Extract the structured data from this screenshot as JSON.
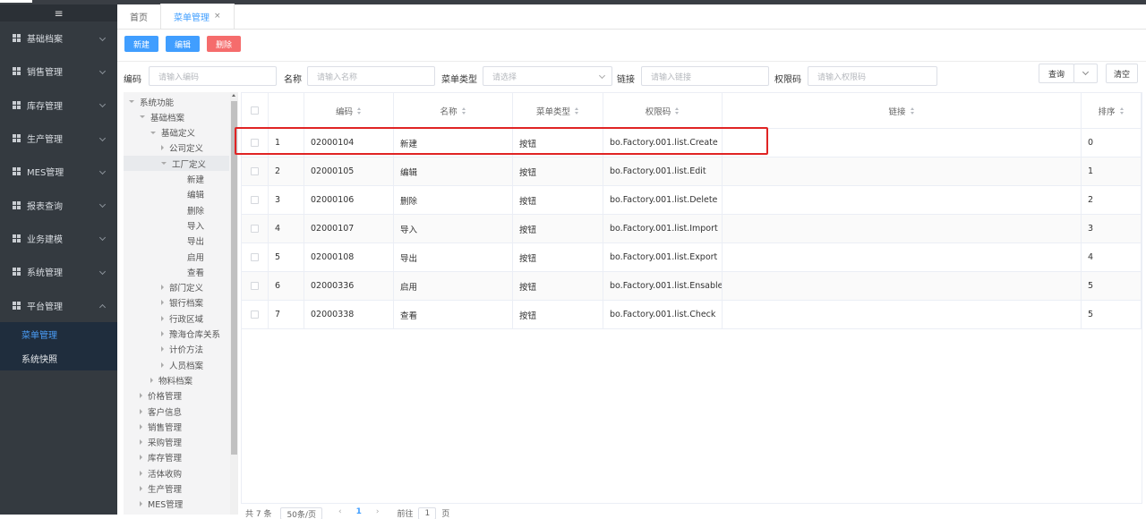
{
  "sidebar": {
    "toggle_icon": "≡",
    "items": [
      {
        "label": "基础档案"
      },
      {
        "label": "销售管理"
      },
      {
        "label": "库存管理"
      },
      {
        "label": "生产管理"
      },
      {
        "label": "MES管理"
      },
      {
        "label": "报表查询"
      },
      {
        "label": "业务建模"
      },
      {
        "label": "系统管理"
      },
      {
        "label": "平台管理"
      }
    ],
    "sub_items": [
      {
        "label": "菜单管理",
        "active": true
      },
      {
        "label": "系统快照",
        "active": false
      }
    ]
  },
  "tabs": [
    {
      "label": "首页",
      "active": false
    },
    {
      "label": "菜单管理",
      "active": true,
      "close": "×"
    }
  ],
  "toolbar": {
    "new_label": "新建",
    "edit_label": "编辑",
    "delete_label": "删除"
  },
  "filter": {
    "code_label": "编码",
    "code_placeholder": "请输入编码",
    "name_label": "名称",
    "name_placeholder": "请输入名称",
    "type_label": "菜单类型",
    "type_placeholder": "请选择",
    "link_label": "链接",
    "link_placeholder": "请输入链接",
    "perm_label": "权限码",
    "perm_placeholder": "请输入权限码",
    "query_label": "查询",
    "clear_label": "清空"
  },
  "tree": [
    {
      "label": "系统功能"
    },
    {
      "label": "基础档案"
    },
    {
      "label": "基础定义"
    },
    {
      "label": "公司定义"
    },
    {
      "label": "工厂定义"
    },
    {
      "label": "新建"
    },
    {
      "label": "编辑"
    },
    {
      "label": "删除"
    },
    {
      "label": "导入"
    },
    {
      "label": "导出"
    },
    {
      "label": "启用"
    },
    {
      "label": "查看"
    },
    {
      "label": "部门定义"
    },
    {
      "label": "银行档案"
    },
    {
      "label": "行政区域"
    },
    {
      "label": "豫海仓库关系"
    },
    {
      "label": "计价方法"
    },
    {
      "label": "人员档案"
    },
    {
      "label": "物料档案"
    },
    {
      "label": "价格管理"
    },
    {
      "label": "客户信息"
    },
    {
      "label": "销售管理"
    },
    {
      "label": "采购管理"
    },
    {
      "label": "库存管理"
    },
    {
      "label": "活体收购"
    },
    {
      "label": "生产管理"
    },
    {
      "label": "MES管理"
    }
  ],
  "table": {
    "headers": {
      "code": "编码",
      "name": "名称",
      "type": "菜单类型",
      "perm": "权限码",
      "link": "链接",
      "sort": "排序"
    },
    "rows": [
      {
        "idx": "1",
        "code": "02000104",
        "name": "新建",
        "type": "按钮",
        "perm": "bo.Factory.001.list.Create",
        "link": "",
        "sort": "0"
      },
      {
        "idx": "2",
        "code": "02000105",
        "name": "编辑",
        "type": "按钮",
        "perm": "bo.Factory.001.list.Edit",
        "link": "",
        "sort": "1"
      },
      {
        "idx": "3",
        "code": "02000106",
        "name": "删除",
        "type": "按钮",
        "perm": "bo.Factory.001.list.Delete",
        "link": "",
        "sort": "2"
      },
      {
        "idx": "4",
        "code": "02000107",
        "name": "导入",
        "type": "按钮",
        "perm": "bo.Factory.001.list.Import",
        "link": "",
        "sort": "3"
      },
      {
        "idx": "5",
        "code": "02000108",
        "name": "导出",
        "type": "按钮",
        "perm": "bo.Factory.001.list.Export",
        "link": "",
        "sort": "4"
      },
      {
        "idx": "6",
        "code": "02000336",
        "name": "启用",
        "type": "按钮",
        "perm": "bo.Factory.001.list.Ensable",
        "link": "",
        "sort": "5"
      },
      {
        "idx": "7",
        "code": "02000338",
        "name": "查看",
        "type": "按钮",
        "perm": "bo.Factory.001.list.Check",
        "link": "",
        "sort": "5"
      }
    ]
  },
  "pager": {
    "total": "共 7 条",
    "page_size": "50条/页",
    "current": "1",
    "goto_label": "前往",
    "goto_value": "1",
    "page_unit": "页"
  },
  "colors": {
    "accent": "#409eff",
    "danger": "#f56c6c",
    "highlight_box": "#e02424",
    "sidebar_bg": "#343a40"
  }
}
